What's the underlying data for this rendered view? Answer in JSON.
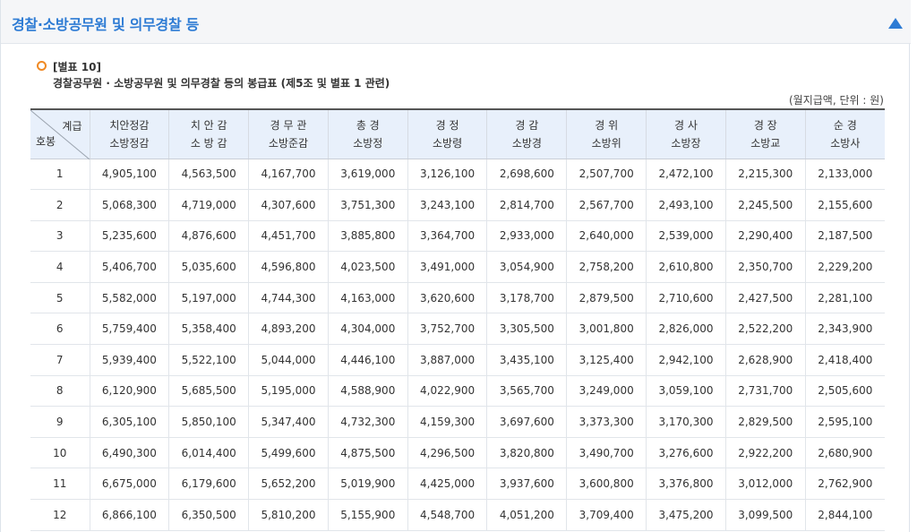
{
  "header": {
    "title": "경찰·소방공무원 및 의무경찰 등",
    "collapse_icon": "triangle-up-icon",
    "accent_color": "#2d7bd4"
  },
  "notice": {
    "icon": "ring-bullet-icon",
    "icon_color": "#f08a24",
    "code": "[별표 10]",
    "description": "경찰공무원 · 소방공무원 및 의무경찰 등의 봉급표 (제5조 및 별표 1 관련)"
  },
  "unit_note": "(월지급액, 단위 : 원)",
  "table": {
    "corner": {
      "top": "계급",
      "bottom": "호봉"
    },
    "columns": [
      {
        "line1": "치안정감",
        "line2": "소방정감"
      },
      {
        "line1": "치 안 감",
        "line2": "소 방 감"
      },
      {
        "line1": "경 무 관",
        "line2": "소방준감"
      },
      {
        "line1": "총 경",
        "line2": "소방정"
      },
      {
        "line1": "경 정",
        "line2": "소방령"
      },
      {
        "line1": "경 감",
        "line2": "소방경"
      },
      {
        "line1": "경 위",
        "line2": "소방위"
      },
      {
        "line1": "경 사",
        "line2": "소방장"
      },
      {
        "line1": "경 장",
        "line2": "소방교"
      },
      {
        "line1": "순 경",
        "line2": "소방사"
      }
    ],
    "rows": [
      {
        "step": "1",
        "values": [
          "4,905,100",
          "4,563,500",
          "4,167,700",
          "3,619,000",
          "3,126,100",
          "2,698,600",
          "2,507,700",
          "2,472,100",
          "2,215,300",
          "2,133,000"
        ]
      },
      {
        "step": "2",
        "values": [
          "5,068,300",
          "4,719,000",
          "4,307,600",
          "3,751,300",
          "3,243,100",
          "2,814,700",
          "2,567,700",
          "2,493,100",
          "2,245,500",
          "2,155,600"
        ]
      },
      {
        "step": "3",
        "values": [
          "5,235,600",
          "4,876,600",
          "4,451,700",
          "3,885,800",
          "3,364,700",
          "2,933,000",
          "2,640,000",
          "2,539,000",
          "2,290,400",
          "2,187,500"
        ]
      },
      {
        "step": "4",
        "values": [
          "5,406,700",
          "5,035,600",
          "4,596,800",
          "4,023,500",
          "3,491,000",
          "3,054,900",
          "2,758,200",
          "2,610,800",
          "2,350,700",
          "2,229,200"
        ]
      },
      {
        "step": "5",
        "values": [
          "5,582,000",
          "5,197,000",
          "4,744,300",
          "4,163,000",
          "3,620,600",
          "3,178,700",
          "2,879,500",
          "2,710,600",
          "2,427,500",
          "2,281,100"
        ]
      },
      {
        "step": "6",
        "values": [
          "5,759,400",
          "5,358,400",
          "4,893,200",
          "4,304,000",
          "3,752,700",
          "3,305,500",
          "3,001,800",
          "2,826,000",
          "2,522,200",
          "2,343,900"
        ]
      },
      {
        "step": "7",
        "values": [
          "5,939,400",
          "5,522,100",
          "5,044,000",
          "4,446,100",
          "3,887,000",
          "3,435,100",
          "3,125,400",
          "2,942,100",
          "2,628,900",
          "2,418,400"
        ]
      },
      {
        "step": "8",
        "values": [
          "6,120,900",
          "5,685,500",
          "5,195,000",
          "4,588,900",
          "4,022,900",
          "3,565,700",
          "3,249,000",
          "3,059,100",
          "2,731,700",
          "2,505,600"
        ]
      },
      {
        "step": "9",
        "values": [
          "6,305,100",
          "5,850,100",
          "5,347,400",
          "4,732,300",
          "4,159,300",
          "3,697,600",
          "3,373,300",
          "3,170,300",
          "2,829,500",
          "2,595,100"
        ]
      },
      {
        "step": "10",
        "values": [
          "6,490,300",
          "6,014,400",
          "5,499,600",
          "4,875,500",
          "4,296,500",
          "3,820,800",
          "3,490,700",
          "3,276,600",
          "2,922,200",
          "2,680,900"
        ]
      },
      {
        "step": "11",
        "values": [
          "6,675,000",
          "6,179,600",
          "5,652,200",
          "5,019,900",
          "4,425,000",
          "3,937,600",
          "3,600,800",
          "3,376,800",
          "3,012,000",
          "2,762,900"
        ]
      },
      {
        "step": "12",
        "values": [
          "6,866,100",
          "6,350,500",
          "5,810,200",
          "5,155,900",
          "4,548,700",
          "4,051,200",
          "3,709,400",
          "3,475,200",
          "3,099,500",
          "2,844,100"
        ]
      }
    ]
  }
}
